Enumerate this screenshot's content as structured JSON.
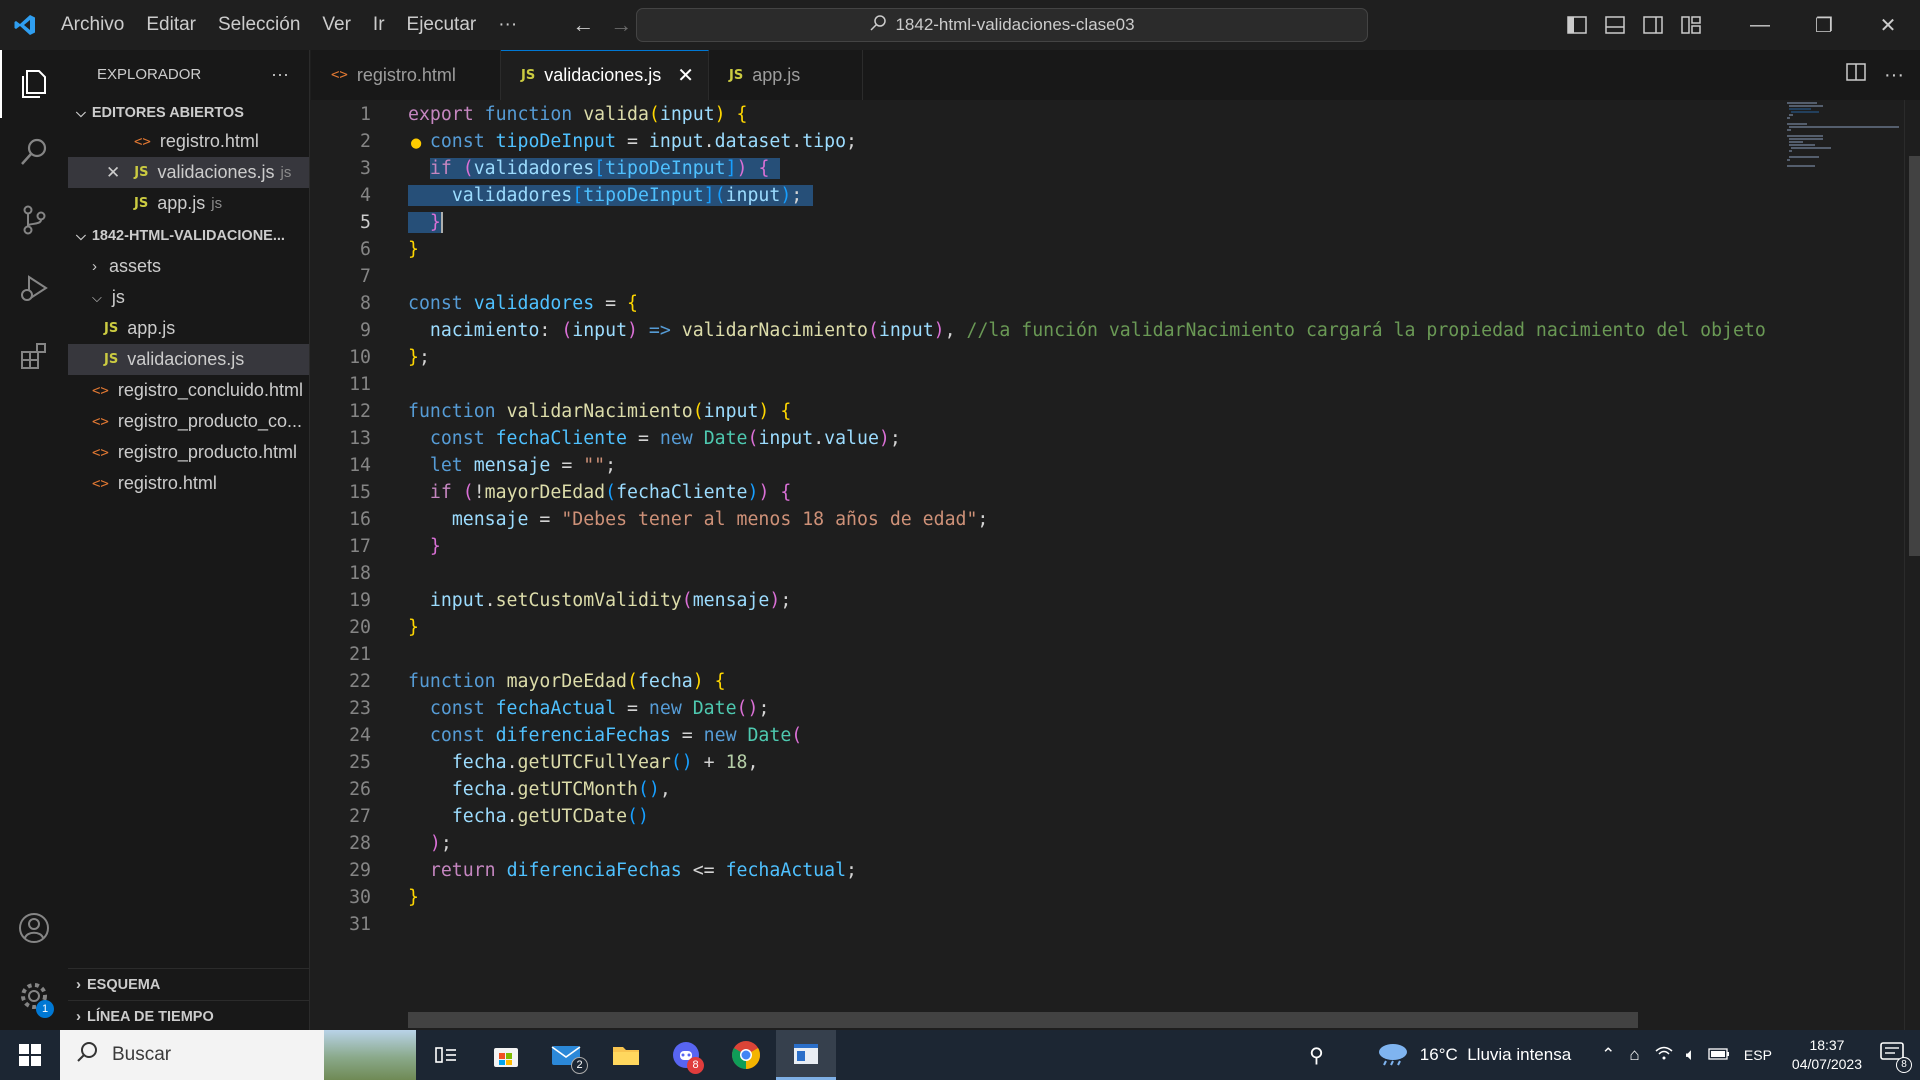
{
  "titlebar": {
    "menu": [
      "Archivo",
      "Editar",
      "Selección",
      "Ver",
      "Ir",
      "Ejecutar",
      "···"
    ],
    "search_text": "1842-html-validaciones-clase03"
  },
  "sidebar": {
    "title": "EXPLORADOR",
    "more": "···",
    "open_editors_title": "EDITORES ABIERTOS",
    "open_editors": [
      {
        "name": "registro.html",
        "dir": "",
        "type": "html"
      },
      {
        "name": "validaciones.js",
        "dir": "js",
        "type": "js"
      },
      {
        "name": "app.js",
        "dir": "js",
        "type": "js"
      }
    ],
    "project_title": "1842-HTML-VALIDACIONE...",
    "tree": [
      {
        "name": "assets",
        "type": "folder"
      },
      {
        "name": "js",
        "type": "folder-open"
      },
      {
        "name": "app.js",
        "type": "js"
      },
      {
        "name": "validaciones.js",
        "type": "js"
      },
      {
        "name": "registro_concluido.html",
        "type": "html"
      },
      {
        "name": "registro_producto_co...",
        "type": "html"
      },
      {
        "name": "registro_producto.html",
        "type": "html"
      },
      {
        "name": "registro.html",
        "type": "html"
      }
    ],
    "outline_title": "ESQUEMA",
    "timeline_title": "LÍNEA DE TIEMPO"
  },
  "tabs": [
    {
      "label": "registro.html",
      "type": "html"
    },
    {
      "label": "validaciones.js",
      "type": "js"
    },
    {
      "label": "app.js",
      "type": "js"
    }
  ],
  "editor": {
    "line_numbers": [
      "1",
      "2",
      "3",
      "4",
      "5",
      "6",
      "7",
      "8",
      "9",
      "10",
      "11",
      "12",
      "13",
      "14",
      "15",
      "16",
      "17",
      "18",
      "19",
      "20",
      "21",
      "22",
      "23",
      "24",
      "25",
      "26",
      "27",
      "28",
      "29",
      "30",
      "31"
    ],
    "comment_line9": "//la función validarNacimiento cargará la propiedad nacimiento del objeto",
    "string_line16": "\"Debes tener al menos 18 años de edad\"",
    "number_line25": "18"
  },
  "activity": {
    "settings_badge": "1"
  },
  "taskbar": {
    "search_placeholder": "Buscar",
    "mail_badge": "2",
    "discord_badge": "8",
    "weather": "16°C  Lluvia intensa",
    "lang": "ESP",
    "time": "18:37",
    "date": "04/07/2023",
    "notif_count": "8"
  }
}
